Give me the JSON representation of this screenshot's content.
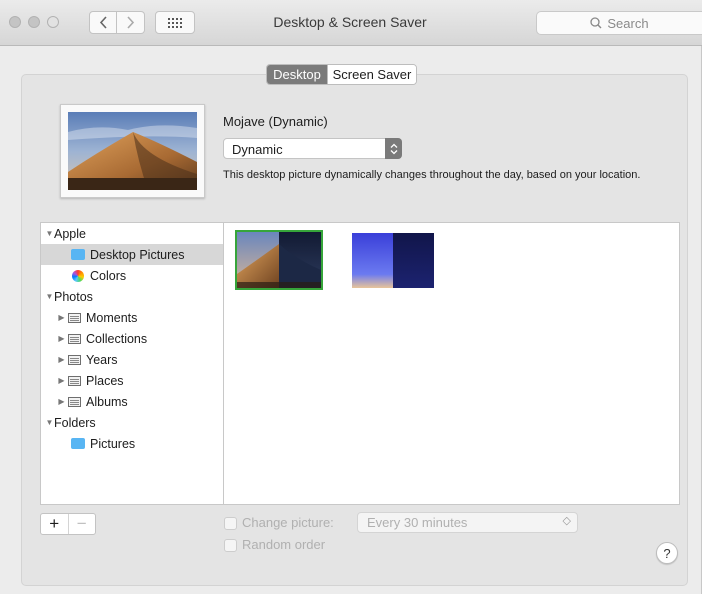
{
  "window": {
    "title": "Desktop & Screen Saver"
  },
  "toolbar": {
    "search_placeholder": "Search",
    "grid_icon": "grid-icon",
    "back_icon": "chevron-left-icon",
    "forward_icon": "chevron-right-icon"
  },
  "tabs": [
    {
      "label": "Desktop",
      "active": true
    },
    {
      "label": "Screen Saver",
      "active": false
    }
  ],
  "current": {
    "name": "Mojave (Dynamic)",
    "mode": "Dynamic",
    "description": "This desktop picture dynamically changes throughout the day, based on your location."
  },
  "sidebar": {
    "items": [
      {
        "label": "Apple",
        "type": "group"
      },
      {
        "label": "Desktop Pictures",
        "icon": "folder-icon",
        "selected": true
      },
      {
        "label": "Colors",
        "icon": "color-wheel-icon"
      },
      {
        "label": "Photos",
        "type": "group"
      },
      {
        "label": "Moments",
        "icon": "album-icon"
      },
      {
        "label": "Collections",
        "icon": "album-icon"
      },
      {
        "label": "Years",
        "icon": "album-icon"
      },
      {
        "label": "Places",
        "icon": "album-icon"
      },
      {
        "label": "Albums",
        "icon": "album-icon"
      },
      {
        "label": "Folders",
        "type": "group"
      },
      {
        "label": "Pictures",
        "icon": "pictures-folder-icon"
      }
    ]
  },
  "controls": {
    "add": "+",
    "remove": "−",
    "change_picture_label": "Change picture:",
    "change_interval": "Every 30 minutes",
    "random_label": "Random order",
    "help": "?"
  },
  "colors": {
    "accent_selected": "#36a53a",
    "segment_active": "#7b7b7b",
    "folder_blue": "#58b5f3"
  }
}
